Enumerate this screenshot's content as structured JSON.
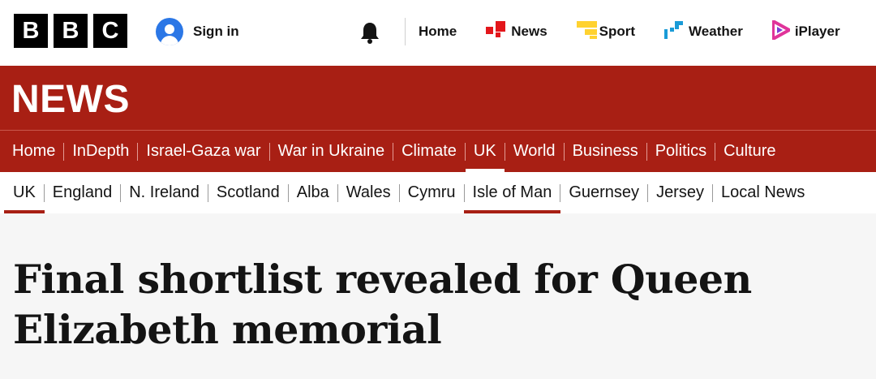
{
  "masthead": {
    "logo_letters": [
      "B",
      "B",
      "C"
    ],
    "sign_in_label": "Sign in",
    "nav": [
      {
        "label": "Home",
        "icon": "none"
      },
      {
        "label": "News",
        "icon": "news-icon",
        "color": "#e3161b"
      },
      {
        "label": "Sport",
        "icon": "sport-icon",
        "color": "#ffd230"
      },
      {
        "label": "Weather",
        "icon": "weather-icon",
        "color": "#1a9bd7"
      },
      {
        "label": "iPlayer",
        "icon": "iplayer-icon",
        "color": "#e0349a"
      }
    ]
  },
  "banner": {
    "title": "NEWS",
    "color": "#a81f14",
    "primary_nav": [
      "Home",
      "InDepth",
      "Israel-Gaza war",
      "War in Ukraine",
      "Climate",
      "UK",
      "World",
      "Business",
      "Politics",
      "Culture"
    ],
    "primary_active": "UK"
  },
  "secondary_nav": {
    "items": [
      "UK",
      "England",
      "N. Ireland",
      "Scotland",
      "Alba",
      "Wales",
      "Cymru",
      "Isle of Man",
      "Guernsey",
      "Jersey",
      "Local News"
    ],
    "active": [
      "UK",
      "Isle of Man"
    ]
  },
  "article": {
    "headline": "Final shortlist revealed for Queen Elizabeth memorial"
  }
}
